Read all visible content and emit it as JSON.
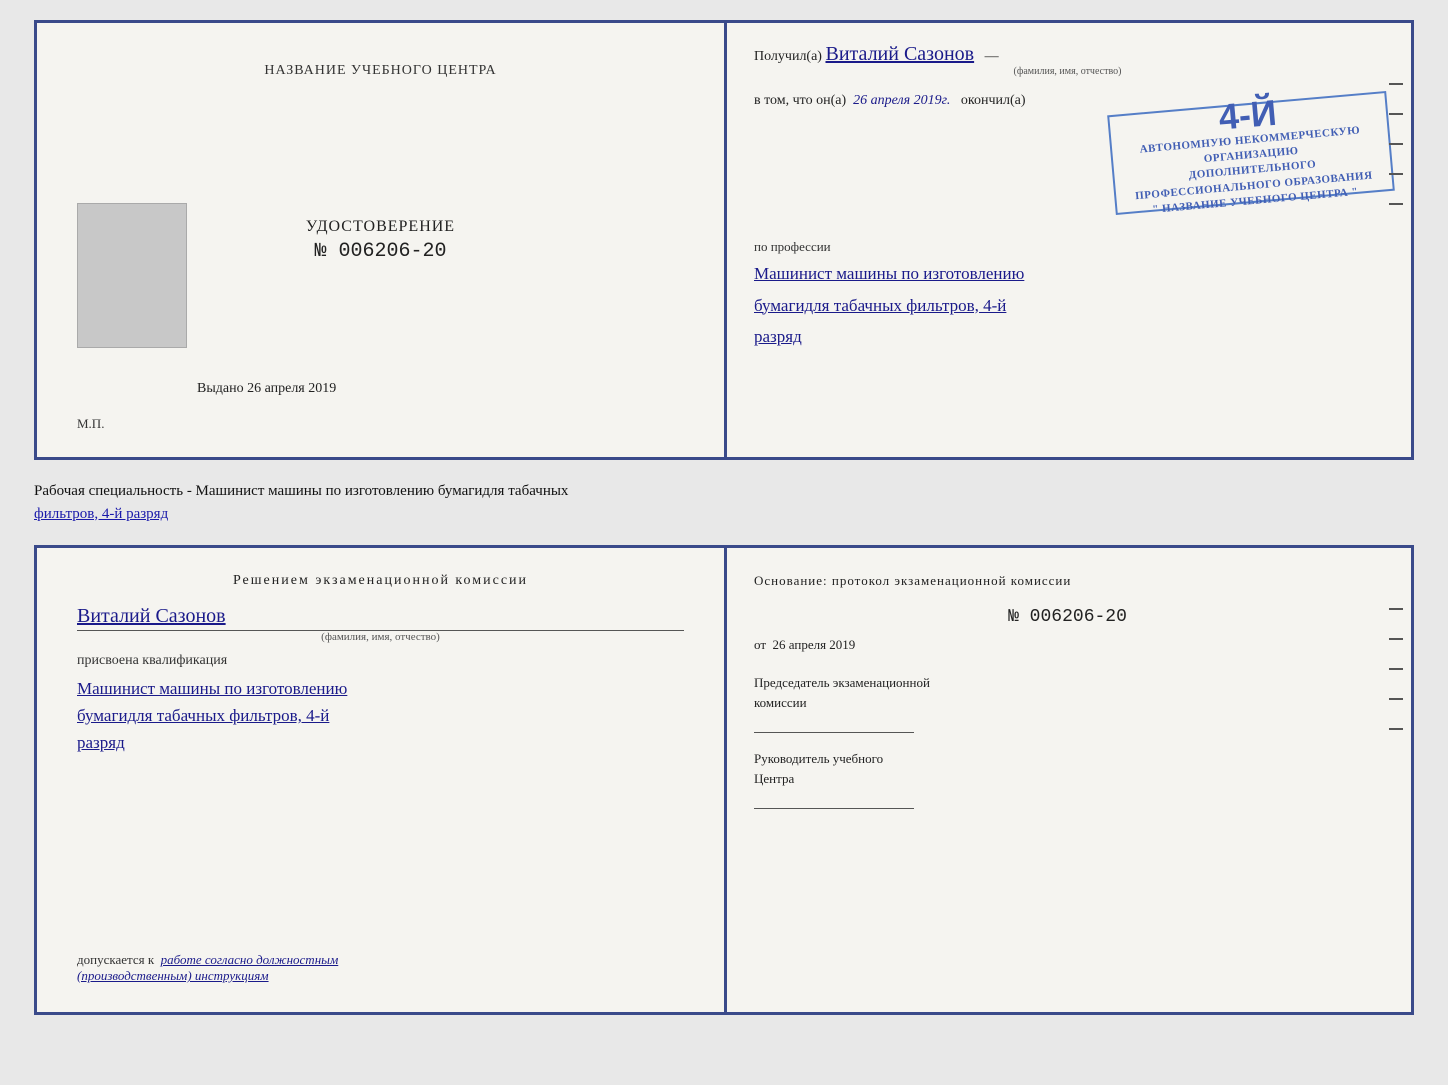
{
  "top_cert": {
    "left": {
      "header": "НАЗВАНИЕ УЧЕБНОГО ЦЕНТРА",
      "udostoverenie_title": "УДОСТОВЕРЕНИЕ",
      "number": "№ 006206-20",
      "vydano_label": "Выдано",
      "vydano_date": "26 апреля 2019",
      "mp_label": "М.П."
    },
    "right": {
      "poluchil_prefix": "Получил(а)",
      "recipient_name": "Виталий Сазонов",
      "name_sublabel": "(фамилия, имя, отчество)",
      "vtom_prefix": "в том, что он(а)",
      "date_handwritten": "26 апреля 2019г.",
      "okonchil": "окончил(а)",
      "stamp_line1": "4-Й",
      "stamp_line2": "АВТОНОМНУЮ НЕКОММЕРЧЕСКУЮ ОРГАНИЗАЦИЮ",
      "stamp_line3": "ДОПОЛНИТЕЛЬНОГО ПРОФЕССИОНАЛЬНОГО ОБРАЗОВАНИЯ",
      "stamp_line4": "\" НАЗВАНИЕ УЧЕБНОГО ЦЕНТРА \"",
      "po_professii": "по профессии",
      "profession_line1": "Машинист машины по изготовлению",
      "profession_line2": "бумагидля табачных фильтров, 4-й",
      "profession_line3": "разряд"
    }
  },
  "middle": {
    "text_prefix": "Рабочая специальность - Машинист машины по изготовлению бумагидля табачных",
    "text_underline": "фильтров, 4-й разряд"
  },
  "bottom_cert": {
    "left": {
      "resolution_title": "Решением  экзаменационной  комиссии",
      "name_handwritten": "Виталий Сазонов",
      "name_sublabel": "(фамилия, имя, отчество)",
      "prisvoena_label": "присвоена квалификация",
      "qualification_line1": "Машинист машины по изготовлению",
      "qualification_line2": "бумагидля табачных фильтров, 4-й",
      "qualification_line3": "разряд",
      "dopuskaetsya_prefix": "допускается к",
      "dopuskaetsya_italic": "работе согласно должностным",
      "dopuskaetsya_italic2": "(производственным) инструкциям"
    },
    "right": {
      "osnovanie_label": "Основание: протокол экзаменационной  комиссии",
      "protocol_number": "№  006206-20",
      "ot_prefix": "от",
      "ot_date": "26 апреля 2019",
      "predsedatel_label": "Председатель экзаменационной",
      "predsedatel_label2": "комиссии",
      "rukovoditel_label": "Руководитель учебного",
      "rukovoditel_label2": "Центра"
    }
  }
}
